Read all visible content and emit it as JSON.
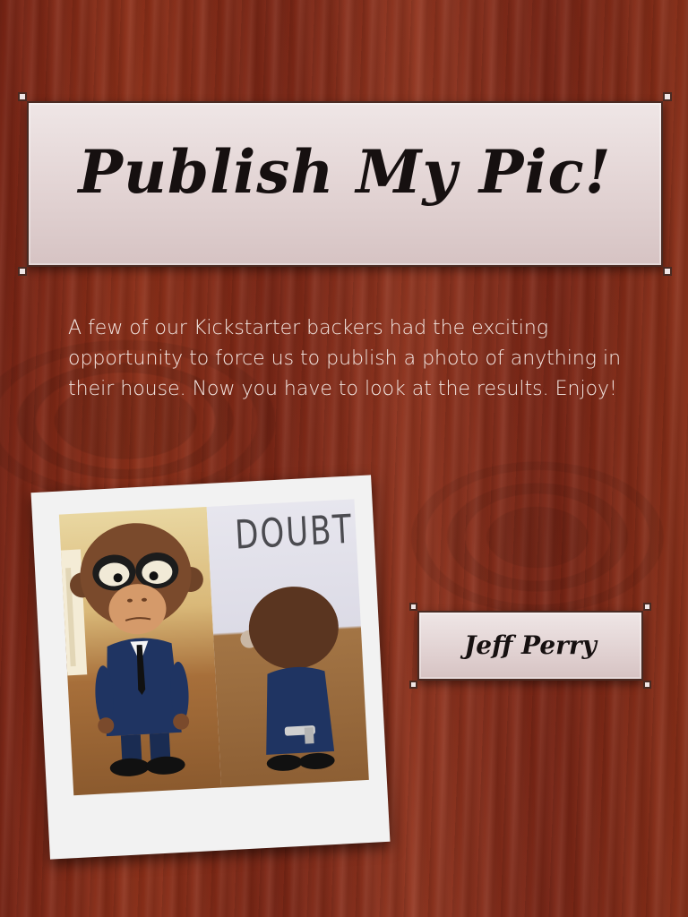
{
  "title": "Publish My Pic!",
  "intro": "A few of our Kickstarter backers had the exciting opportunity to force us to publish a photo of anything in their house. Now you have to look at the results. Enjoy!",
  "photo": {
    "sign_text": "DOUBT"
  },
  "name": "Jeff Perry"
}
